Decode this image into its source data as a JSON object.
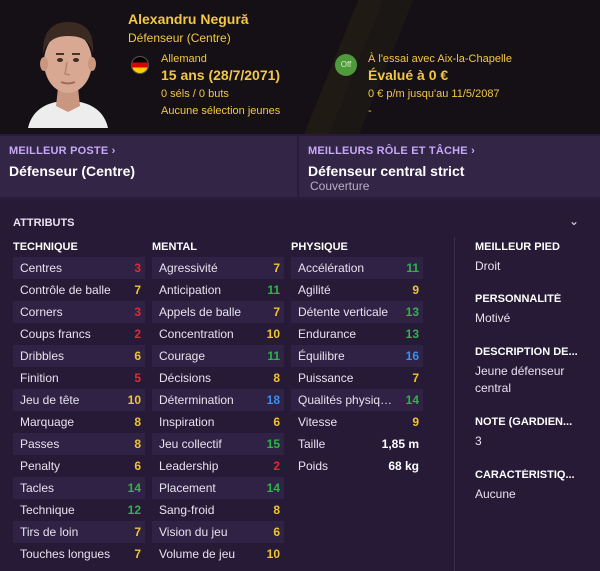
{
  "player": {
    "name": "Alexandru Negură",
    "role": "Défenseur (Centre)",
    "nationality": "Allemand",
    "age": "15 ans (28/7/2071)",
    "caps": "0 séls / 0 buts",
    "youth_selection": "Aucune sélection jeunes",
    "status_badge": "Off",
    "trial": "À l'essai avec Aix-la-Chapelle",
    "value": "Évalué à 0 €",
    "contract": "0 € p/m jusqu'au 11/5/2087",
    "dash": "-"
  },
  "best_position": {
    "title": "MEILLEUR POSTE",
    "value": "Défenseur (Centre)"
  },
  "best_role": {
    "title": "MEILLEURS RÔLE ET TÂCHE",
    "value": "Défenseur central strict",
    "duty": "Couverture"
  },
  "attributes": {
    "title": "ATTRIBUTS",
    "technical": {
      "title": "TECHNIQUE",
      "items": [
        {
          "label": "Centres",
          "value": "3",
          "color": "red"
        },
        {
          "label": "Contrôle de balle",
          "value": "7",
          "color": "yel"
        },
        {
          "label": "Corners",
          "value": "3",
          "color": "red"
        },
        {
          "label": "Coups francs",
          "value": "2",
          "color": "red"
        },
        {
          "label": "Dribbles",
          "value": "6",
          "color": "yel"
        },
        {
          "label": "Finition",
          "value": "5",
          "color": "red"
        },
        {
          "label": "Jeu de tête",
          "value": "10",
          "color": "yel"
        },
        {
          "label": "Marquage",
          "value": "8",
          "color": "yel"
        },
        {
          "label": "Passes",
          "value": "8",
          "color": "yel"
        },
        {
          "label": "Penalty",
          "value": "6",
          "color": "yel"
        },
        {
          "label": "Tacles",
          "value": "14",
          "color": "grn"
        },
        {
          "label": "Technique",
          "value": "12",
          "color": "grn"
        },
        {
          "label": "Tirs de loin",
          "value": "7",
          "color": "yel"
        },
        {
          "label": "Touches longues",
          "value": "7",
          "color": "yel"
        }
      ]
    },
    "mental": {
      "title": "MENTAL",
      "items": [
        {
          "label": "Agressivité",
          "value": "7",
          "color": "yel"
        },
        {
          "label": "Anticipation",
          "value": "11",
          "color": "grn"
        },
        {
          "label": "Appels de balle",
          "value": "7",
          "color": "yel"
        },
        {
          "label": "Concentration",
          "value": "10",
          "color": "yel"
        },
        {
          "label": "Courage",
          "value": "11",
          "color": "grn"
        },
        {
          "label": "Décisions",
          "value": "8",
          "color": "yel"
        },
        {
          "label": "Détermination",
          "value": "18",
          "color": "blu"
        },
        {
          "label": "Inspiration",
          "value": "6",
          "color": "yel"
        },
        {
          "label": "Jeu collectif",
          "value": "15",
          "color": "grn"
        },
        {
          "label": "Leadership",
          "value": "2",
          "color": "red"
        },
        {
          "label": "Placement",
          "value": "14",
          "color": "grn"
        },
        {
          "label": "Sang-froid",
          "value": "8",
          "color": "yel"
        },
        {
          "label": "Vision du jeu",
          "value": "6",
          "color": "yel"
        },
        {
          "label": "Volume de jeu",
          "value": "10",
          "color": "yel"
        }
      ]
    },
    "physical": {
      "title": "PHYSIQUE",
      "items": [
        {
          "label": "Accélération",
          "value": "11",
          "color": "grn"
        },
        {
          "label": "Agilité",
          "value": "9",
          "color": "yel"
        },
        {
          "label": "Détente verticale",
          "value": "13",
          "color": "grn"
        },
        {
          "label": "Endurance",
          "value": "13",
          "color": "grn"
        },
        {
          "label": "Équilibre",
          "value": "16",
          "color": "blu"
        },
        {
          "label": "Puissance",
          "value": "7",
          "color": "yel"
        },
        {
          "label": "Qualités physiques",
          "value": "14",
          "color": "grn"
        },
        {
          "label": "Vitesse",
          "value": "9",
          "color": "yel"
        }
      ],
      "height_label": "Taille",
      "height": "1,85 m",
      "weight_label": "Poids",
      "weight": "68 kg"
    }
  },
  "info": {
    "preferred_foot_title": "MEILLEUR PIED",
    "preferred_foot": "Droit",
    "personality_title": "PERSONNALITÉ",
    "personality": "Motivé",
    "description_title": "DESCRIPTION DE...",
    "description": "Jeune défenseur central",
    "gk_rating_title": "NOTE (GARDIEN...",
    "gk_rating": "3",
    "traits_title": "CARACTÉRISTIQ...",
    "traits": "Aucune"
  }
}
